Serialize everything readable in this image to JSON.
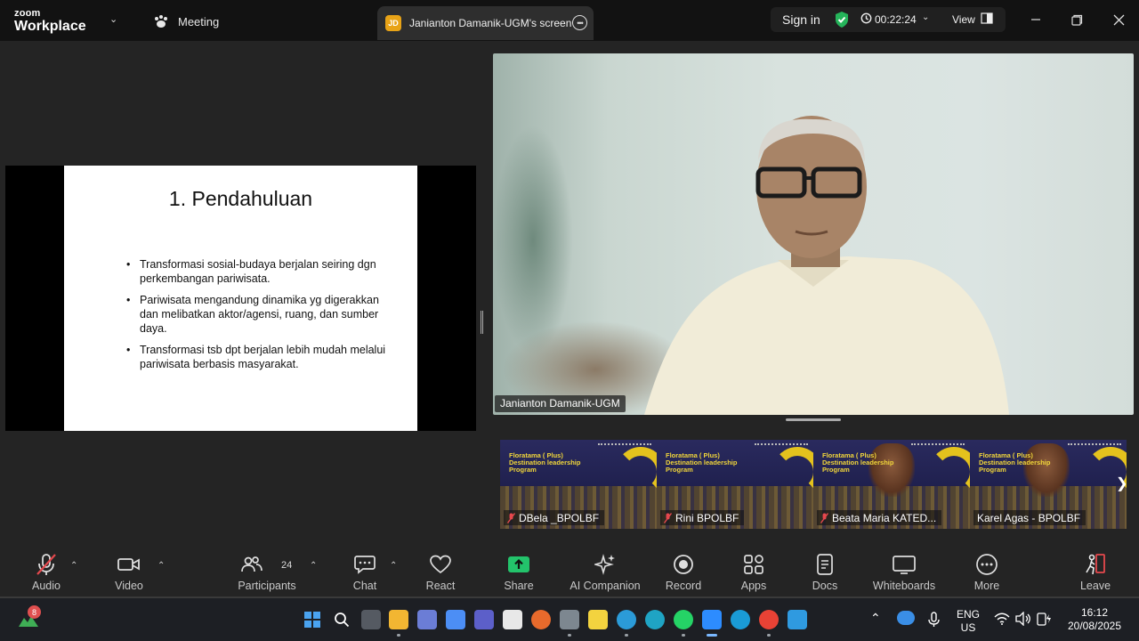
{
  "app": {
    "logo_line1": "zoom",
    "logo_line2": "Workplace",
    "meeting_label": "Meeting",
    "screen_tab": {
      "avatar": "JD",
      "label": "Janianton Damanik-UGM's screen"
    },
    "sign_in": "Sign in",
    "timer": "00:22:24",
    "view_label": "View"
  },
  "slide": {
    "title": "1. Pendahuluan",
    "bullets": [
      "Transformasi sosial-budaya berjalan seiring dgn perkembangan pariwisata.",
      "Pariwisata mengandung dinamika yg digerakkan dan melibatkan aktor/agensi, ruang, dan sumber daya.",
      "Transformasi tsb dpt berjalan lebih mudah melalui pariwisata berbasis masyarakat."
    ]
  },
  "speaker": {
    "name": "Janianton Damanik-UGM"
  },
  "thumbnails": [
    {
      "name": "DBela _BPOLBF",
      "banner": "Floratama ( Plus) Destination leadership Program"
    },
    {
      "name": "Rini BPOLBF",
      "banner": "Floratama ( Plus) Destination leadership Program"
    },
    {
      "name": "Beata Maria KATED...",
      "banner": "Floratama ( Plus) Destination leadership Program"
    },
    {
      "name": "Karel Agas - BPOLBF",
      "banner": "Floratama ( Plus) Destination leadership Program"
    }
  ],
  "toolbar": {
    "audio": "Audio",
    "video": "Video",
    "participants": "Participants",
    "participants_count": "24",
    "chat": "Chat",
    "react": "React",
    "share": "Share",
    "ai_companion": "AI Companion",
    "record": "Record",
    "apps": "Apps",
    "docs": "Docs",
    "whiteboards": "Whiteboards",
    "more": "More",
    "leave": "Leave"
  },
  "taskbar": {
    "notification_count": "8",
    "lang_line1": "ENG",
    "lang_line2": "US",
    "time": "16:12",
    "date": "20/08/2025"
  },
  "colors": {
    "share_green": "#23c36b",
    "shield_green": "#25b45a",
    "audio_muted_red": "#e5484d",
    "leave_red": "#e5484d",
    "slide_bg": "#ffffff",
    "banner_yellow": "#e4c21d"
  }
}
